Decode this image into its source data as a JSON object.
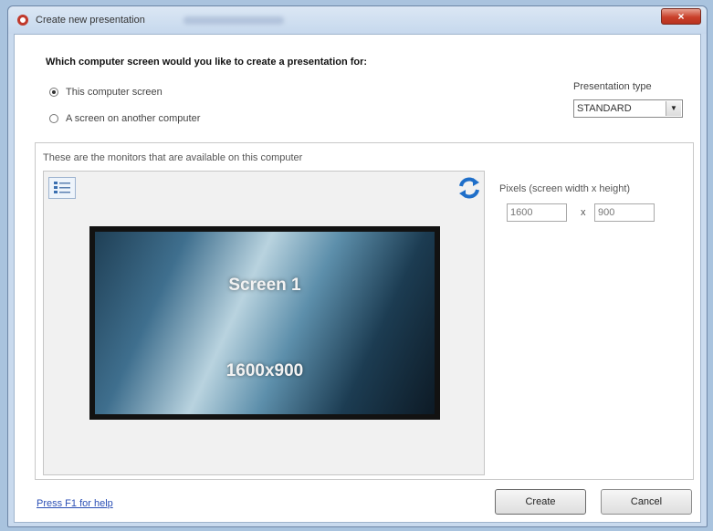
{
  "window": {
    "title": "Create new presentation",
    "close_glyph": "×"
  },
  "question": "Which computer screen would you like to create a presentation for:",
  "options": [
    {
      "label": "This computer screen",
      "checked": true
    },
    {
      "label": "A screen on another computer",
      "checked": false
    }
  ],
  "presentation_type": {
    "label": "Presentation type",
    "value": "STANDARD",
    "arrow_glyph": "▼"
  },
  "monitors": {
    "label": "These are the monitors that are available on this computer",
    "screen_name": "Screen 1",
    "screen_resolution": "1600x900"
  },
  "pixels": {
    "label": "Pixels (screen width x height)",
    "width": "1600",
    "separator": "x",
    "height": "900"
  },
  "footer": {
    "help_link": "Press F1 for help",
    "create_label": "Create",
    "cancel_label": "Cancel"
  },
  "icons": {
    "app": "app-icon",
    "list": "list-view-icon",
    "refresh": "refresh-icon"
  },
  "colors": {
    "accent": "#2b7fd1",
    "close": "#c9402a"
  }
}
